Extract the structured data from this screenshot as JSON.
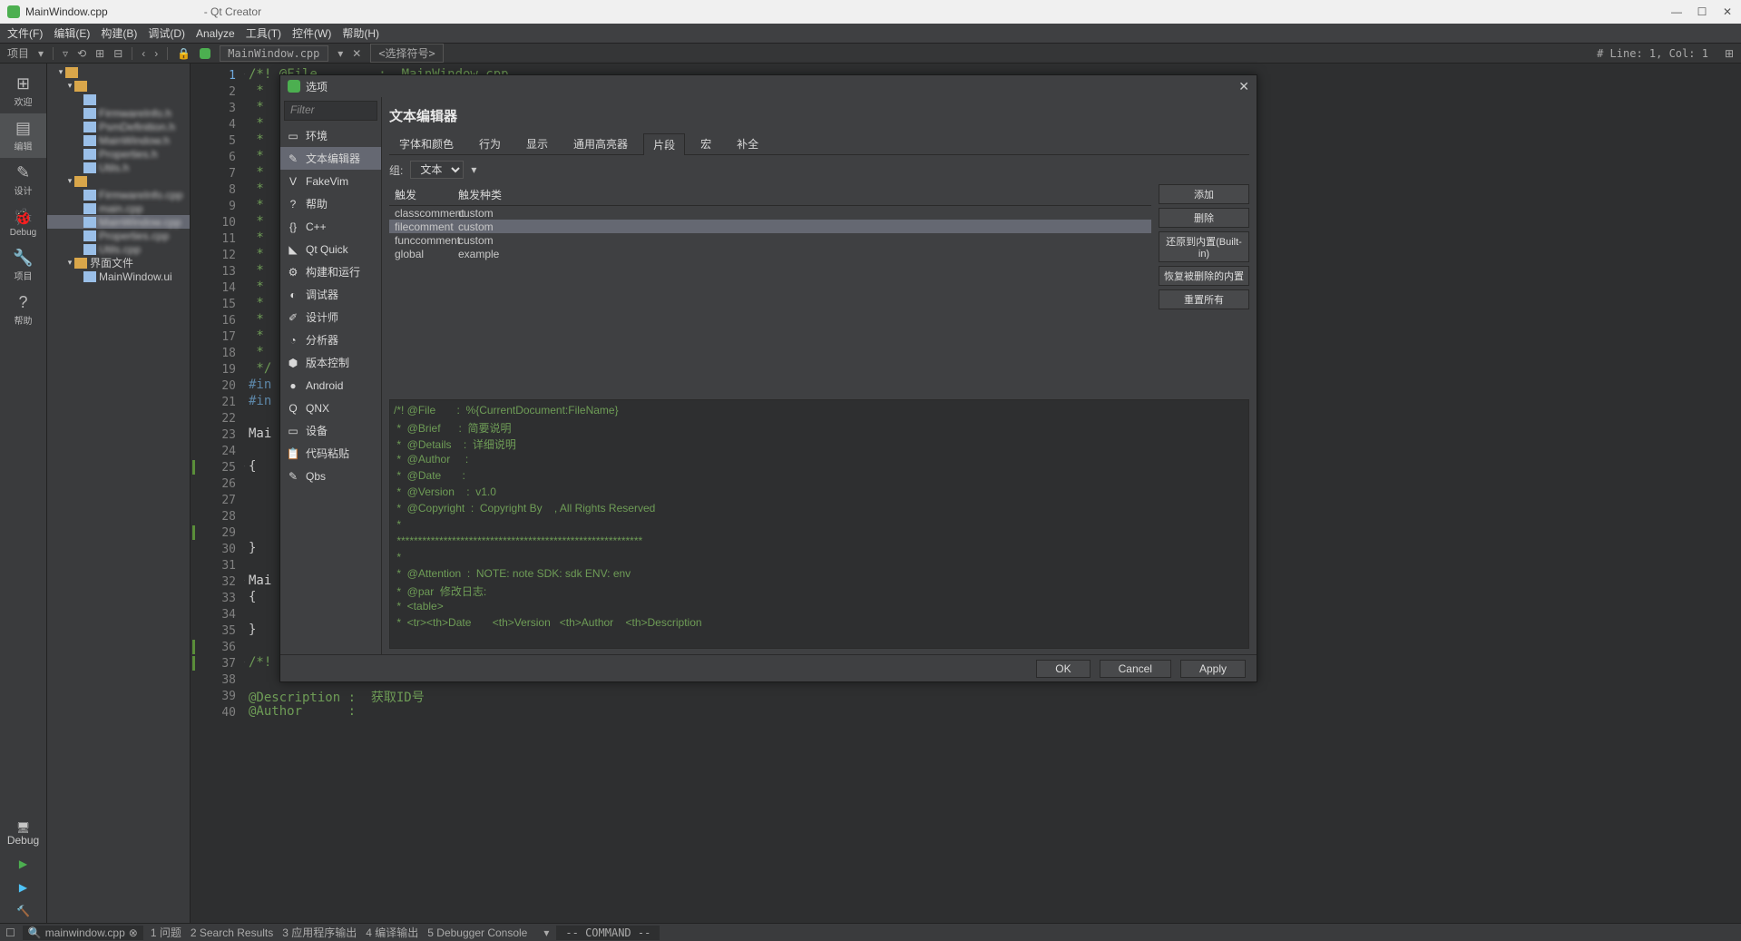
{
  "window": {
    "title": "MainWindow.cpp",
    "app": "- Qt Creator"
  },
  "menus": [
    "文件(F)",
    "编辑(E)",
    "构建(B)",
    "调试(D)",
    "Analyze",
    "工具(T)",
    "控件(W)",
    "帮助(H)"
  ],
  "toolbar": {
    "project_label": "项目",
    "filetab": "MainWindow.cpp",
    "symbol_sel": "<选择符号>",
    "linecol": "# Line: 1, Col: 1"
  },
  "actbar": [
    {
      "l": "欢迎",
      "i": "⊞"
    },
    {
      "l": "编辑",
      "i": "▤",
      "sel": true
    },
    {
      "l": "设计",
      "i": "✎"
    },
    {
      "l": "Debug",
      "i": "🐞"
    },
    {
      "l": "项目",
      "i": "🔧"
    },
    {
      "l": "帮助",
      "i": "?"
    }
  ],
  "actbar_bottom": {
    "debug": "Debug"
  },
  "tree": [
    {
      "d": 1,
      "tw": "▾",
      "ic": "folder",
      "t": "",
      "blur": true
    },
    {
      "d": 2,
      "tw": "▾",
      "ic": "folder",
      "t": "",
      "blur": true
    },
    {
      "d": 3,
      "tw": "",
      "ic": "filec",
      "t": "",
      "blur": true
    },
    {
      "d": 3,
      "tw": "",
      "ic": "filec",
      "t": "FirmwareInfo.h",
      "blur": true
    },
    {
      "d": 3,
      "tw": "",
      "ic": "filec",
      "t": "PsmDefinition.h",
      "blur": true
    },
    {
      "d": 3,
      "tw": "",
      "ic": "filec",
      "t": "MainWindow.h",
      "blur": true
    },
    {
      "d": 3,
      "tw": "",
      "ic": "filec",
      "t": "Properties.h",
      "blur": true
    },
    {
      "d": 3,
      "tw": "",
      "ic": "filec",
      "t": "Utils.h",
      "blur": true
    },
    {
      "d": 2,
      "tw": "▾",
      "ic": "folder",
      "t": "",
      "blur": true
    },
    {
      "d": 3,
      "tw": "",
      "ic": "filec",
      "t": "FirmwareInfo.cpp",
      "blur": true
    },
    {
      "d": 3,
      "tw": "",
      "ic": "filec",
      "t": "main.cpp",
      "blur": true
    },
    {
      "d": 3,
      "tw": "",
      "ic": "filec",
      "t": "MainWindow.cpp",
      "blur": true,
      "sel": true
    },
    {
      "d": 3,
      "tw": "",
      "ic": "filec",
      "t": "Properties.cpp",
      "blur": true
    },
    {
      "d": 3,
      "tw": "",
      "ic": "filec",
      "t": "Utils.cpp",
      "blur": true
    },
    {
      "d": 2,
      "tw": "▾",
      "ic": "folder",
      "t": "界面文件"
    },
    {
      "d": 3,
      "tw": "",
      "ic": "filec",
      "t": "MainWindow.ui"
    }
  ],
  "gutter_lines": 40,
  "editor_lines": [
    {
      "cls": "cm",
      "t": "/*! @File        :  MainWindow.cpp"
    },
    {
      "cls": "cm",
      "t": " *"
    },
    {
      "cls": "cm",
      "t": " *"
    },
    {
      "cls": "cm",
      "t": " *"
    },
    {
      "cls": "cm",
      "t": " *"
    },
    {
      "cls": "cm",
      "t": " *"
    },
    {
      "cls": "cm",
      "t": " *"
    },
    {
      "cls": "cm",
      "t": " *"
    },
    {
      "cls": "cm",
      "t": " *"
    },
    {
      "cls": "cm",
      "t": " *"
    },
    {
      "cls": "cm",
      "t": " *"
    },
    {
      "cls": "cm",
      "t": " *"
    },
    {
      "cls": "cm",
      "t": " *"
    },
    {
      "cls": "cm",
      "t": " *"
    },
    {
      "cls": "cm",
      "t": " *"
    },
    {
      "cls": "cm",
      "t": " *"
    },
    {
      "cls": "cm",
      "t": " *"
    },
    {
      "cls": "cm",
      "t": " *"
    },
    {
      "cls": "cm",
      "t": " */"
    },
    {
      "cls": "pp",
      "t": "#in"
    },
    {
      "cls": "pp",
      "t": "#in"
    },
    {
      "cls": "",
      "t": ""
    },
    {
      "cls": "id",
      "t": "Mai"
    },
    {
      "cls": "",
      "t": ""
    },
    {
      "cls": "",
      "t": "{"
    },
    {
      "cls": "",
      "t": ""
    },
    {
      "cls": "",
      "t": ""
    },
    {
      "cls": "",
      "t": ""
    },
    {
      "cls": "",
      "t": ""
    },
    {
      "cls": "",
      "t": "}"
    },
    {
      "cls": "",
      "t": ""
    },
    {
      "cls": "id",
      "t": "Mai"
    },
    {
      "cls": "",
      "t": "{"
    },
    {
      "cls": "",
      "t": ""
    },
    {
      "cls": "",
      "t": "}"
    },
    {
      "cls": "",
      "t": ""
    },
    {
      "cls": "cm",
      "t": "/*!"
    },
    {
      "cls": "",
      "t": ""
    },
    {
      "cls": "cm",
      "t": "@Description :  获取ID号"
    },
    {
      "cls": "cm",
      "t": "@Author      : "
    }
  ],
  "dialog": {
    "title": "选项",
    "filter_placeholder": "Filter",
    "categories": [
      {
        "l": "环境",
        "i": "▭"
      },
      {
        "l": "文本编辑器",
        "i": "✎",
        "sel": true
      },
      {
        "l": "FakeVim",
        "i": "V"
      },
      {
        "l": "帮助",
        "i": "?"
      },
      {
        "l": "C++",
        "i": "{}"
      },
      {
        "l": "Qt Quick",
        "i": "◣"
      },
      {
        "l": "构建和运行",
        "i": "⚙"
      },
      {
        "l": "调试器",
        "i": "◐"
      },
      {
        "l": "设计师",
        "i": "✐"
      },
      {
        "l": "分析器",
        "i": "◔"
      },
      {
        "l": "版本控制",
        "i": "⬢"
      },
      {
        "l": "Android",
        "i": "●"
      },
      {
        "l": "QNX",
        "i": "Q"
      },
      {
        "l": "设备",
        "i": "▭"
      },
      {
        "l": "代码粘贴",
        "i": "📋"
      },
      {
        "l": "Qbs",
        "i": "✎"
      }
    ],
    "panel_title": "文本编辑器",
    "tabs": [
      "字体和颜色",
      "行为",
      "显示",
      "通用高亮器",
      "片段",
      "宏",
      "补全"
    ],
    "tab_sel": 4,
    "group_label": "组:",
    "group_value": "文本",
    "list_headers": [
      "触发",
      "触发种类"
    ],
    "snippets": [
      {
        "trig": "classcomment",
        "type": "custom"
      },
      {
        "trig": "filecomment",
        "type": "custom",
        "sel": true
      },
      {
        "trig": "funccomment",
        "type": "custom"
      },
      {
        "trig": "global",
        "type": "example"
      }
    ],
    "side_buttons": [
      "添加",
      "删除",
      "还原到内置(Built-in)",
      "恢复被删除的内置",
      "重置所有"
    ],
    "snippet_code": [
      "/*! @File       :  %{CurrentDocument:FileName}",
      " *  @Brief      :  简要说明",
      " *  @Details    :  详细说明",
      " *  @Author     :  ",
      " *  @Date       :  ",
      " *  @Version    :  v1.0",
      " *  @Copyright  :  Copyright By    , All Rights Reserved",
      " *",
      " **********************************************************",
      " *",
      " *  @Attention  :  NOTE: note SDK: sdk ENV: env",
      " *  @par  修改日志:",
      " *  <table>",
      " *  <tr><th>Date       <th>Version   <th>Author    <th>Description"
    ],
    "buttons": {
      "ok": "OK",
      "cancel": "Cancel",
      "apply": "Apply"
    }
  },
  "status": {
    "search": "mainwindow.cpp",
    "panes": [
      "1 问题",
      "2 Search Results",
      "3 应用程序输出",
      "4 编译输出",
      "5 Debugger Console"
    ],
    "cmd": "-- COMMAND --"
  }
}
